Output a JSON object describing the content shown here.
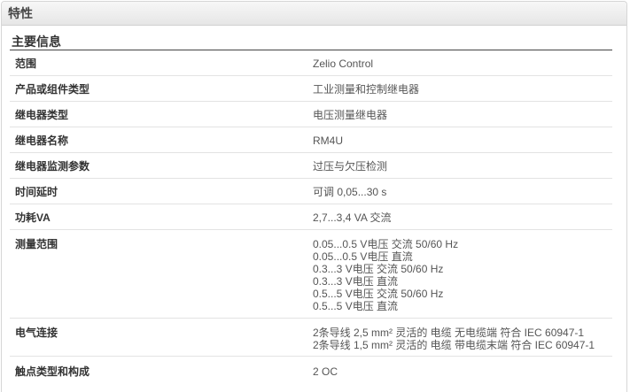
{
  "panel": {
    "title": "特性"
  },
  "section": {
    "title": "主要信息"
  },
  "rows": [
    {
      "label": "范围",
      "value": "Zelio Control"
    },
    {
      "label": "产品或组件类型",
      "value": "工业测量和控制继电器"
    },
    {
      "label": "继电器类型",
      "value": "电压测量继电器"
    },
    {
      "label": "继电器名称",
      "value": "RM4U"
    },
    {
      "label": "继电器监测参数",
      "value": "过压与欠压检测"
    },
    {
      "label": "时间延时",
      "value": "可调 0,05...30 s"
    },
    {
      "label": "功耗VA",
      "value": "2,7...3,4 VA 交流"
    }
  ],
  "measure_range": {
    "label": "测量范围",
    "values": [
      "0.05...0.5 V电压 交流 50/60 Hz",
      "0.05...0.5 V电压 直流",
      "0.3...3 V电压 交流 50/60 Hz",
      "0.3...3 V电压 直流",
      "0.5...5 V电压 交流 50/60 Hz",
      "0.5...5 V电压 直流"
    ]
  },
  "electrical_connection": {
    "label": "电气连接",
    "values": [
      "2条导线 2,5 mm² 灵活的 电缆 无电缆端 符合 IEC 60947-1",
      "2条导线 1,5 mm² 灵活的 电缆 带电缆末端 符合 IEC 60947-1"
    ]
  },
  "contact_type": {
    "label": "触点类型和构成",
    "value": "2 OC"
  }
}
